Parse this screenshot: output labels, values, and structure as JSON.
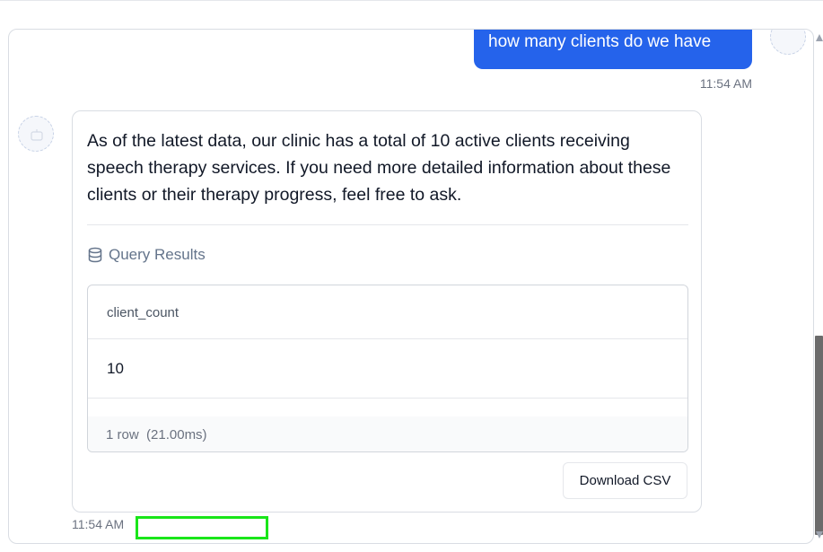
{
  "user_message": {
    "text": "how many clients do we have",
    "time": "11:54 AM"
  },
  "assistant_message": {
    "text": "As of the latest data, our clinic has a total of 10 active clients receiving speech therapy services. If you need more detailed information about these clients or their therapy progress, feel free to ask.",
    "time": "11:54 AM",
    "query_results": {
      "title": "Query Results",
      "columns": [
        "client_count"
      ],
      "rows": [
        [
          "10"
        ]
      ],
      "row_count": "1 row",
      "duration": "(21.00ms)",
      "download_label": "Download CSV"
    }
  },
  "colors": {
    "user_bubble": "#2563eb",
    "highlight": "#19e619"
  },
  "icons": {
    "query_results": "database-icon",
    "user_avatar": "user-avatar",
    "assistant_avatar": "bot-avatar"
  }
}
